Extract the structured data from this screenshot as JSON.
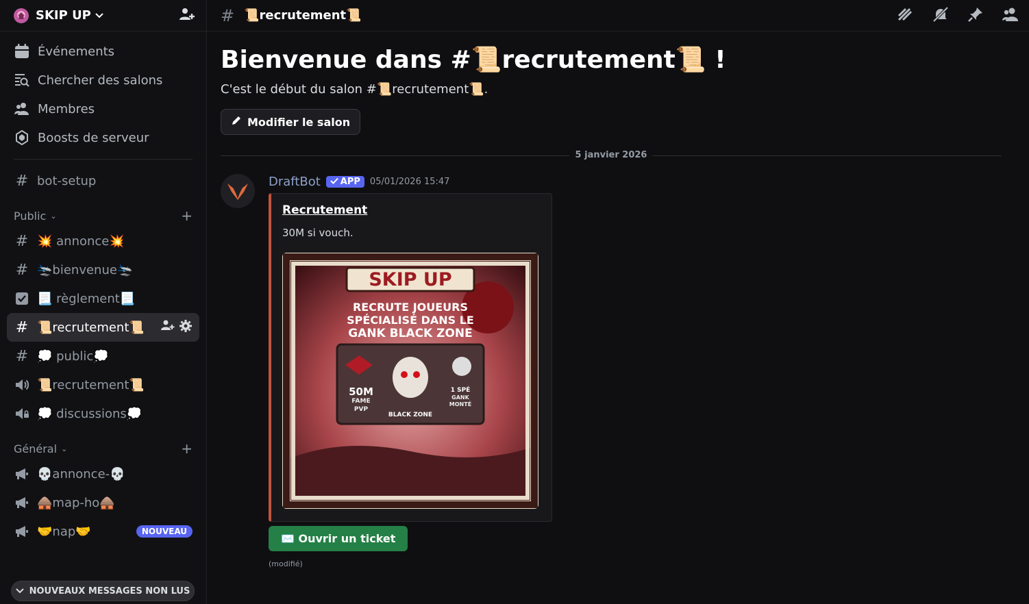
{
  "server": {
    "name": "SKIP UP"
  },
  "top_links": [
    {
      "label": "Événements",
      "icon": "calendar-icon"
    },
    {
      "label": "Chercher des salons",
      "icon": "search-list-icon"
    },
    {
      "label": "Membres",
      "icon": "members-icon"
    },
    {
      "label": "Boosts de serveur",
      "icon": "boost-icon"
    }
  ],
  "channels": {
    "bot_setup": "bot-setup",
    "public_category": "Public",
    "public": [
      {
        "label": "💥 annonce💥",
        "icon": "hash-icon"
      },
      {
        "label": "🛬bienvenue🛬",
        "icon": "hash-icon"
      },
      {
        "label": "📃 règlement📃",
        "icon": "rules-icon"
      },
      {
        "label": "📜recrutement📜",
        "icon": "hash-icon",
        "active": true
      },
      {
        "label": "💭 public💭",
        "icon": "hash-icon"
      },
      {
        "label": "📜recrutement📜",
        "icon": "speaker-icon"
      },
      {
        "label": "💭 discussions💭",
        "icon": "speaker-lock-icon"
      }
    ],
    "general_category": "Général",
    "general": [
      {
        "label": "💀annonce-💀",
        "icon": "megaphone-icon"
      },
      {
        "label": "🛖map-ho🛖",
        "icon": "megaphone-icon"
      },
      {
        "label": "🤝nap🤝",
        "icon": "megaphone-icon",
        "badge": "NOUVEAU"
      }
    ],
    "unread_pill": "NOUVEAUX MESSAGES NON LUS"
  },
  "topbar": {
    "channel_title": "📜recrutement📜"
  },
  "welcome": {
    "heading": "Bienvenue dans #📜recrutement📜 !",
    "subtitle": "C'est le début du salon #📜recrutement📜.",
    "edit_button": "Modifier le salon"
  },
  "date_divider": "5 janvier 2026",
  "message": {
    "author": "DraftBot",
    "tag": "APP",
    "timestamp": "05/01/2026 15:47",
    "embed": {
      "title": "Recrutement",
      "description": "30M si vouch.",
      "image": {
        "title": "SKIP UP",
        "line1": "RECRUTE JOUEURS",
        "line2": "SPÉCIALISÉ DANS LE",
        "line3": "GANK BLACK ZONE",
        "left_stat": "50M",
        "left_sub1": "FAME",
        "left_sub2": "PVP",
        "right_stat": "1 SPÉ",
        "right_sub1": "GANK",
        "right_sub2": "MONTÉ",
        "bottom": "BLACK ZONE"
      }
    },
    "button": "✉️ Ouvrir un ticket",
    "edited": "(modifié)"
  },
  "colors": {
    "accent": "#5865f2",
    "embed_border": "#c1543f",
    "success": "#248046"
  }
}
